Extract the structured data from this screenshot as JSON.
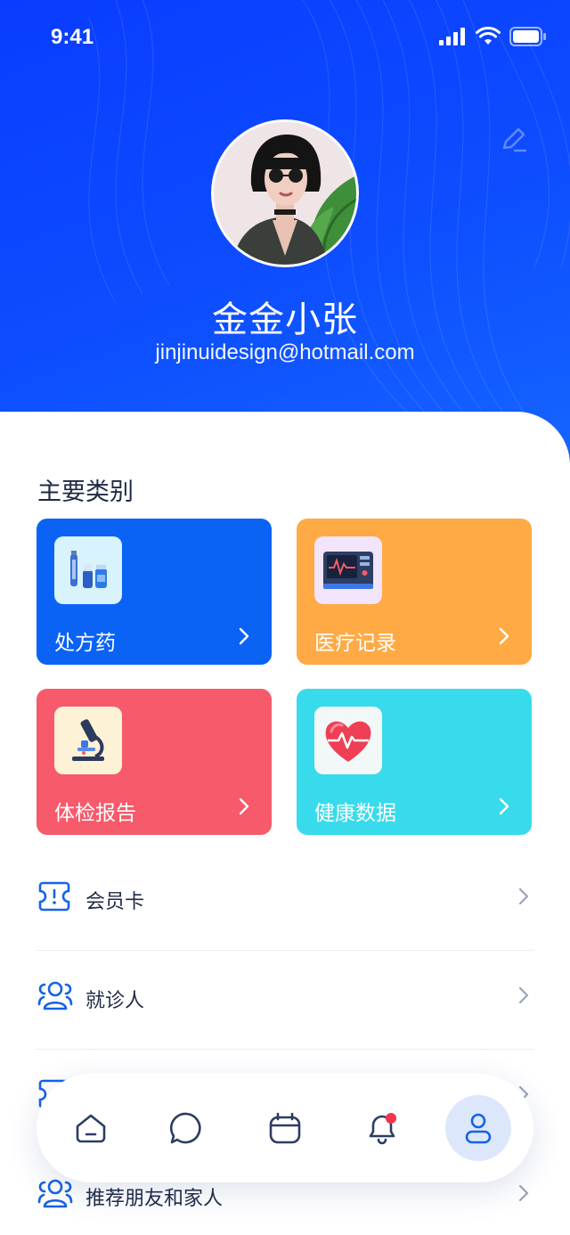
{
  "status_bar": {
    "time": "9:41"
  },
  "profile": {
    "name": "金金小张",
    "email": "jinjinuidesign@hotmail.com"
  },
  "categories": {
    "title": "主要类别",
    "items": [
      {
        "label": "处方药",
        "icon": "medicine-icon",
        "color": "#0b63f6"
      },
      {
        "label": "医疗记录",
        "icon": "monitor-icon",
        "color": "#ffaa45"
      },
      {
        "label": "体检报告",
        "icon": "microscope-icon",
        "color": "#f65a6b"
      },
      {
        "label": "健康数据",
        "icon": "heart-icon",
        "color": "#37dbeb"
      }
    ]
  },
  "menu": [
    {
      "label": "会员卡",
      "icon": "ticket-icon"
    },
    {
      "label": "就诊人",
      "icon": "users-icon"
    },
    {
      "label": "推荐朋友和家人",
      "icon": "users-icon"
    }
  ],
  "bottom_nav": [
    {
      "name": "home",
      "icon": "home-icon"
    },
    {
      "name": "chat",
      "icon": "chat-icon"
    },
    {
      "name": "calendar",
      "icon": "calendar-icon"
    },
    {
      "name": "notifications",
      "icon": "bell-icon",
      "badge": true
    },
    {
      "name": "profile",
      "icon": "user-icon",
      "active": true
    }
  ],
  "colors": {
    "header_blue": "#0a3cff",
    "accent_blue": "#0b63f6",
    "text_dark": "#1f2a44",
    "icon_blue": "#1463e6",
    "badge_red": "#f2344f"
  }
}
